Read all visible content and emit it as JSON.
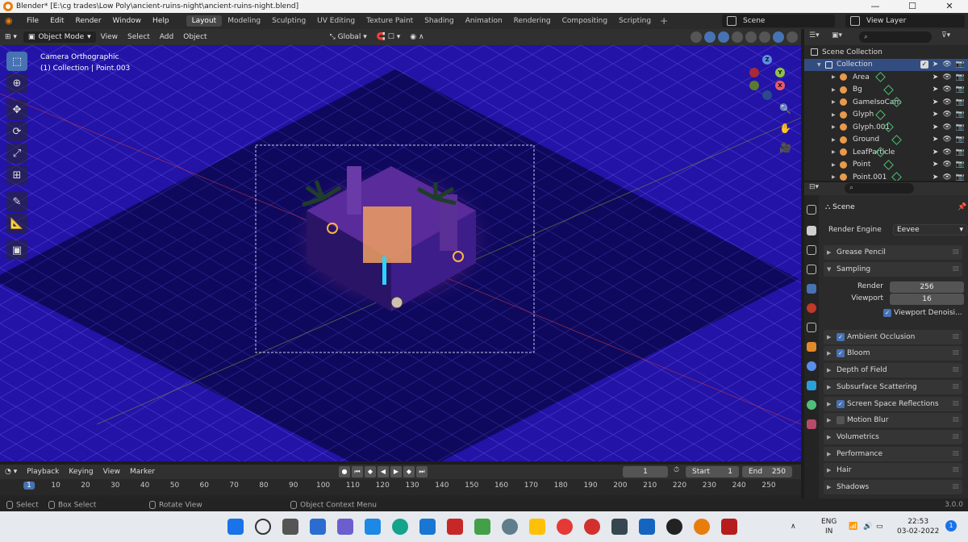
{
  "window": {
    "title": "Blender* [E:\\cg trades\\Low Poly\\ancient-ruins-night\\ancient-ruins-night.blend]",
    "controls": [
      "—",
      "☐",
      "✕"
    ]
  },
  "menu": [
    "File",
    "Edit",
    "Render",
    "Window",
    "Help"
  ],
  "workspaces": [
    {
      "label": "Layout",
      "active": true
    },
    {
      "label": "Modeling",
      "active": false
    },
    {
      "label": "Sculpting",
      "active": false
    },
    {
      "label": "UV Editing",
      "active": false
    },
    {
      "label": "Texture Paint",
      "active": false
    },
    {
      "label": "Shading",
      "active": false
    },
    {
      "label": "Animation",
      "active": false
    },
    {
      "label": "Rendering",
      "active": false
    },
    {
      "label": "Compositing",
      "active": false
    },
    {
      "label": "Scripting",
      "active": false
    }
  ],
  "workspace_add": "+",
  "scene_name": "Scene",
  "view_layer": "View Layer",
  "viewport_header": {
    "mode": "Object Mode",
    "menus": [
      "View",
      "Select",
      "Add",
      "Object"
    ],
    "transform_orientation": "Global"
  },
  "viewport": {
    "camera_label": "Camera Orthographic",
    "collection_label": "(1) Collection | Point.003",
    "background_color": "#1d0e7d",
    "gizmo_axes": [
      "Z",
      "Y",
      "X"
    ]
  },
  "outliner": {
    "header": "Scene Collection",
    "collection": "Collection",
    "items": [
      {
        "label": "Area",
        "icon": "light-icon"
      },
      {
        "label": "Bg",
        "icon": "mesh-icon"
      },
      {
        "label": "GameIsoCam",
        "icon": "camera-icon"
      },
      {
        "label": "Glyph",
        "icon": "mesh-icon"
      },
      {
        "label": "Glyph.001",
        "icon": "mesh-icon"
      },
      {
        "label": "Ground",
        "icon": "mesh-icon"
      },
      {
        "label": "LeafParticle",
        "icon": "mesh-icon"
      },
      {
        "label": "Point",
        "icon": "light-icon"
      },
      {
        "label": "Point.001",
        "icon": "light-icon"
      }
    ]
  },
  "properties": {
    "context": "Scene",
    "render_engine_label": "Render Engine",
    "render_engine": "Eevee",
    "panels": [
      {
        "label": "Grease Pencil",
        "checkbox": null,
        "expanded": false
      },
      {
        "label": "Sampling",
        "checkbox": null,
        "expanded": true
      },
      {
        "label": "Ambient Occlusion",
        "checkbox": true,
        "expanded": false
      },
      {
        "label": "Bloom",
        "checkbox": true,
        "expanded": false
      },
      {
        "label": "Depth of Field",
        "checkbox": null,
        "expanded": false
      },
      {
        "label": "Subsurface Scattering",
        "checkbox": null,
        "expanded": false
      },
      {
        "label": "Screen Space Reflections",
        "checkbox": true,
        "expanded": false
      },
      {
        "label": "Motion Blur",
        "checkbox": false,
        "expanded": false
      },
      {
        "label": "Volumetrics",
        "checkbox": null,
        "expanded": false
      },
      {
        "label": "Performance",
        "checkbox": null,
        "expanded": false
      },
      {
        "label": "Hair",
        "checkbox": null,
        "expanded": false
      },
      {
        "label": "Shadows",
        "checkbox": null,
        "expanded": false
      }
    ],
    "sampling": {
      "render_label": "Render",
      "render_value": "256",
      "viewport_label": "Viewport",
      "viewport_value": "16",
      "denoise_label": "Viewport Denoisi..."
    }
  },
  "timeline": {
    "menus": [
      "Playback",
      "Keying",
      "View",
      "Marker"
    ],
    "current_frame": "1",
    "start_label": "Start",
    "start": "1",
    "end_label": "End",
    "end": "250",
    "ticks": [
      "1",
      "10",
      "20",
      "30",
      "40",
      "50",
      "60",
      "70",
      "80",
      "90",
      "100",
      "110",
      "120",
      "130",
      "140",
      "150",
      "160",
      "170",
      "180",
      "190",
      "200",
      "210",
      "220",
      "230",
      "240",
      "250"
    ]
  },
  "statusbar": {
    "select": "Select",
    "box_select": "Box Select",
    "rotate_view": "Rotate View",
    "context_menu": "Object Context Menu",
    "version": "3.0.0"
  },
  "taskbar": {
    "language": "ENG",
    "region": "IN",
    "time": "22:53",
    "date": "03-02-2022",
    "notifications": "1"
  }
}
